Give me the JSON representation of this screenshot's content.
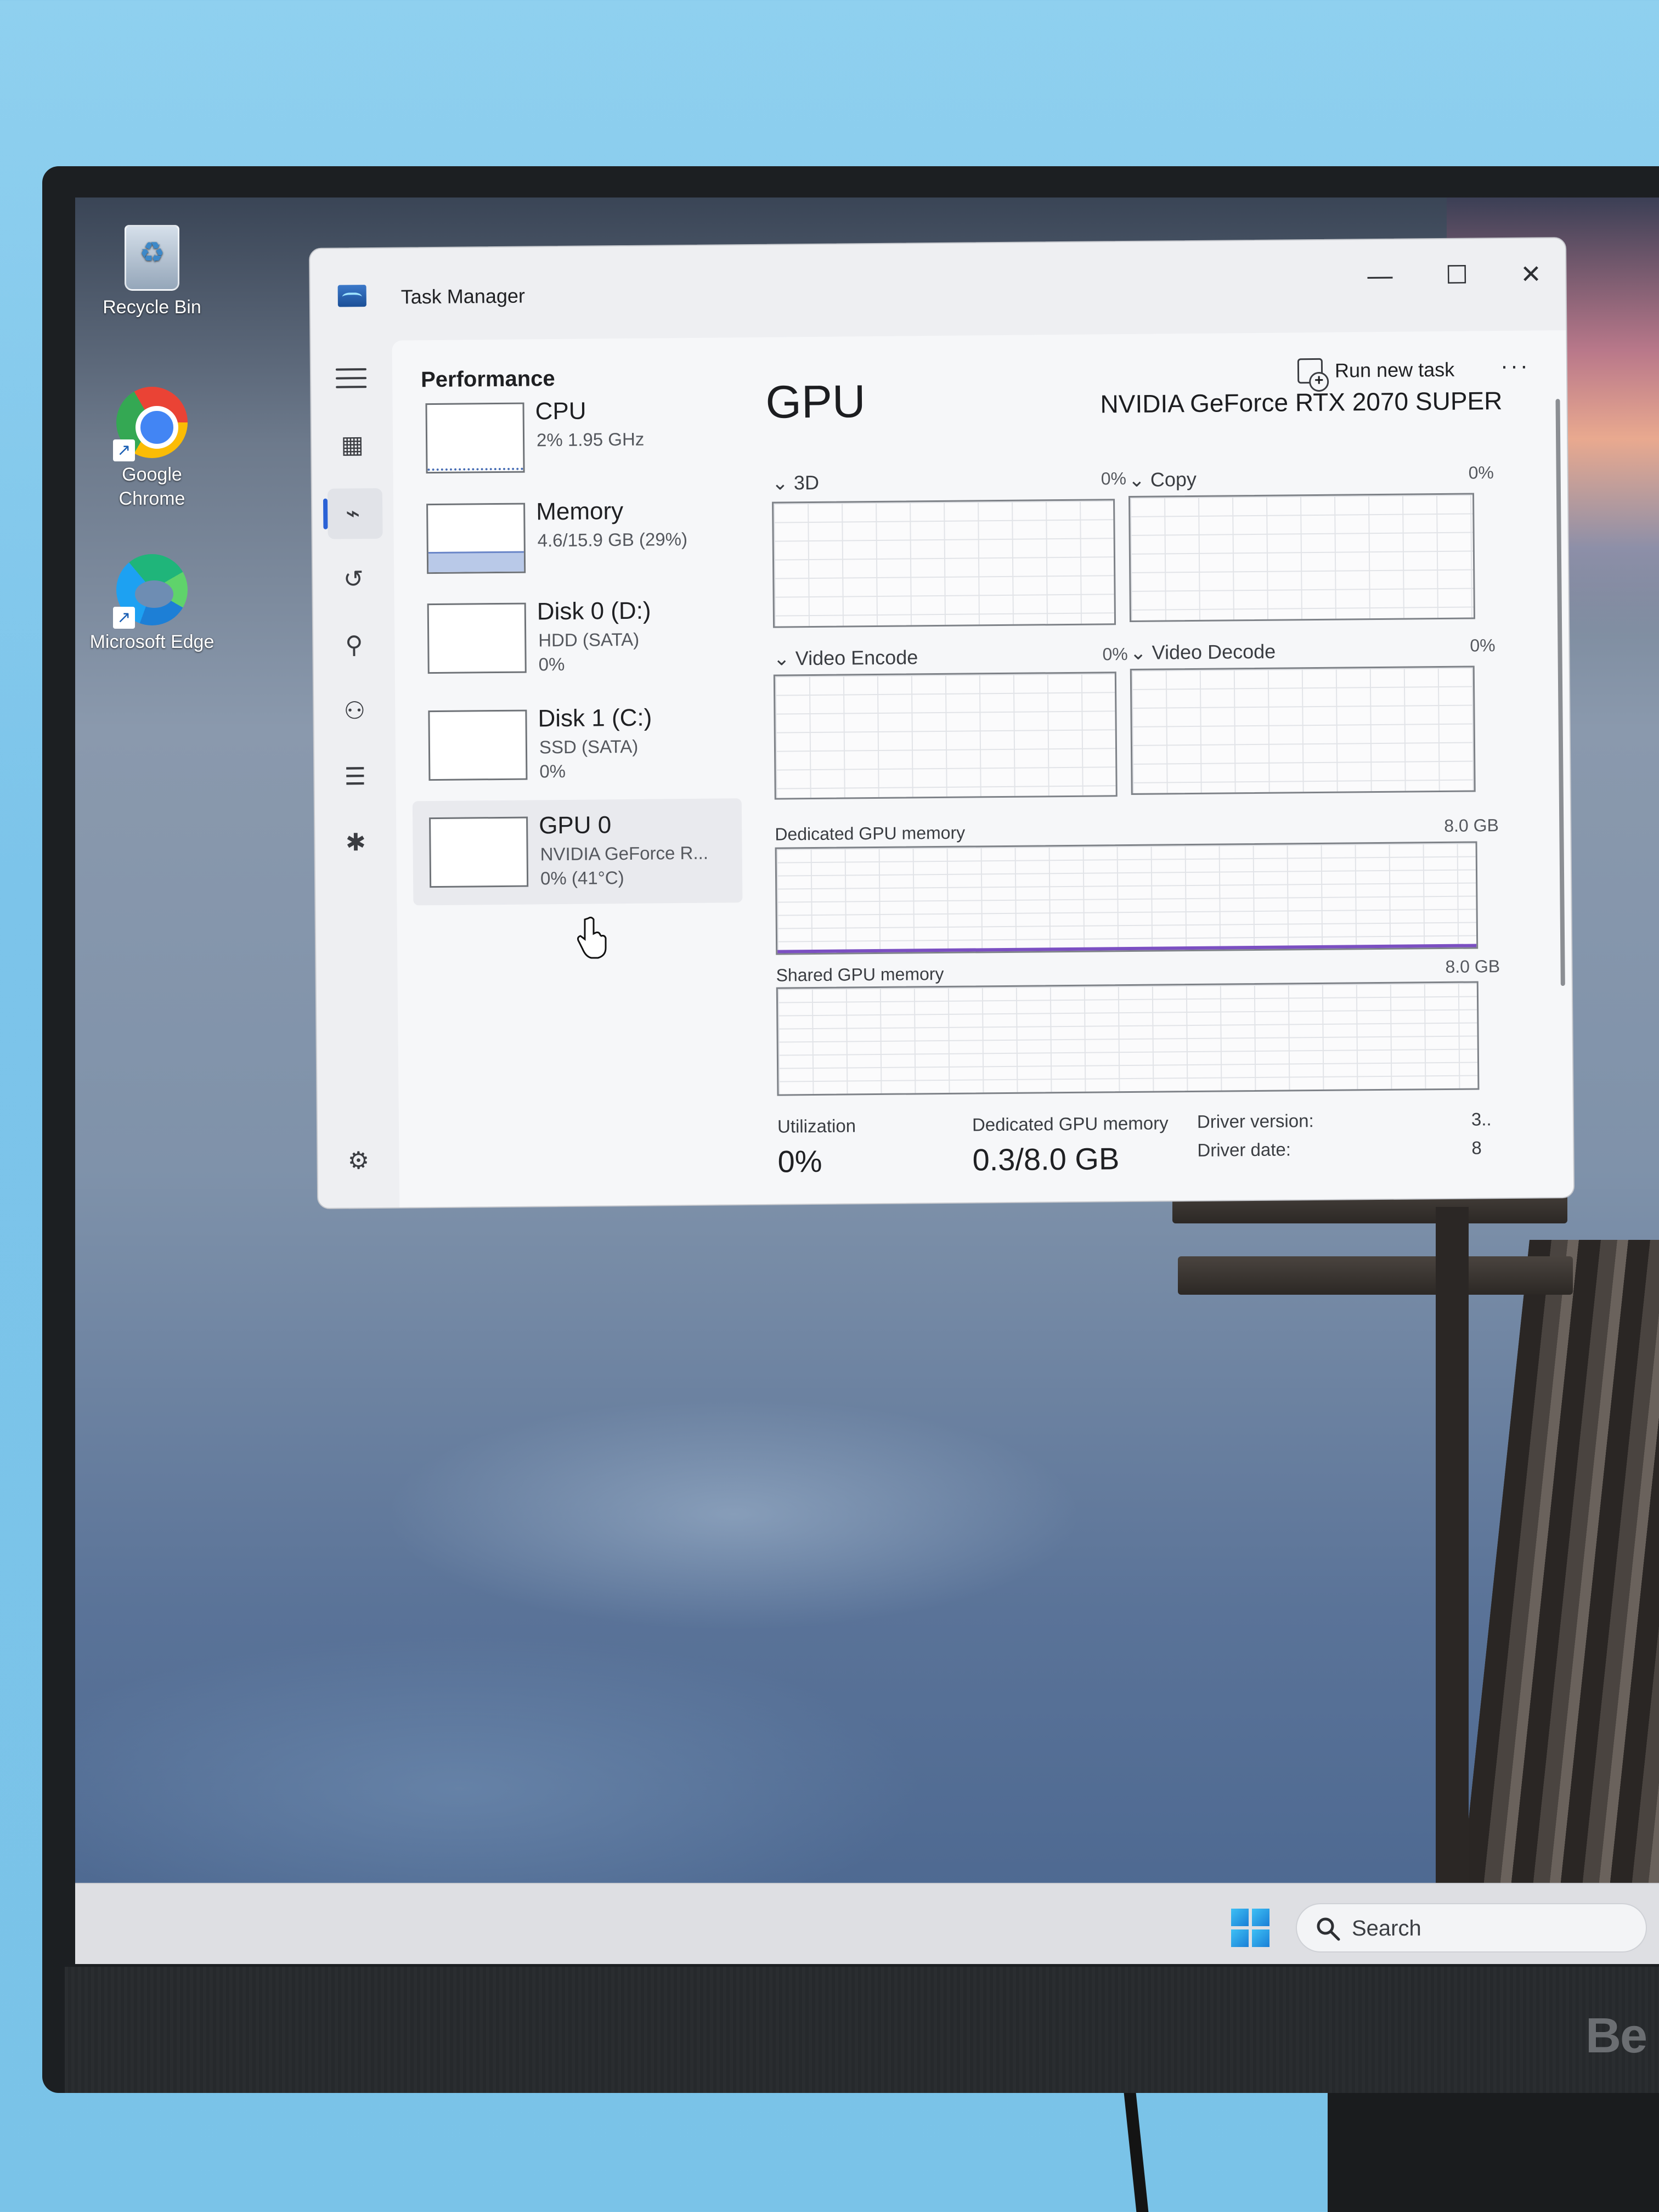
{
  "desktop": {
    "icons": [
      {
        "label": "Recycle Bin"
      },
      {
        "label": "Google Chrome"
      },
      {
        "label": "Microsoft Edge"
      }
    ]
  },
  "taskbar": {
    "search_placeholder": "Search"
  },
  "monitor": {
    "brand": "Be"
  },
  "task_manager": {
    "title": "Task Manager",
    "window_controls": {
      "minimize": "—",
      "maximize": "☐",
      "close": "✕"
    },
    "page_heading": "Performance",
    "run_new_task": "Run new task",
    "more": "···",
    "nav": [
      "hamburger",
      "processes",
      "performance",
      "app-history",
      "startup-apps",
      "users",
      "details",
      "services",
      "settings"
    ],
    "devices": [
      {
        "name": "CPU",
        "line1": "2% 1.95 GHz",
        "line2": ""
      },
      {
        "name": "Memory",
        "line1": "4.6/15.9 GB (29%)",
        "line2": ""
      },
      {
        "name": "Disk 0 (D:)",
        "line1": "HDD (SATA)",
        "line2": "0%"
      },
      {
        "name": "Disk 1 (C:)",
        "line1": "SSD (SATA)",
        "line2": "0%"
      },
      {
        "name": "GPU 0",
        "line1": "NVIDIA GeForce R...",
        "line2": "0% (41°C)"
      }
    ],
    "gpu": {
      "title": "GPU",
      "model": "NVIDIA GeForce RTX 2070 SUPER",
      "engines": [
        {
          "label": "3D",
          "pct": "0%"
        },
        {
          "label": "Copy",
          "pct": "0%"
        },
        {
          "label": "Video Encode",
          "pct": "0%"
        },
        {
          "label": "Video Decode",
          "pct": "0%"
        }
      ],
      "dedicated_label": "Dedicated GPU memory",
      "dedicated_max": "8.0 GB",
      "shared_label": "Shared GPU memory",
      "shared_max": "8.0 GB",
      "stats": {
        "utilization_label": "Utilization",
        "utilization_value": "0%",
        "dedicated_label": "Dedicated GPU memory",
        "dedicated_value": "0.3/8.0 GB",
        "driver_version_label": "Driver version:",
        "driver_version_value": "3..",
        "driver_date_label": "Driver date:",
        "driver_date_value": "8"
      }
    }
  }
}
